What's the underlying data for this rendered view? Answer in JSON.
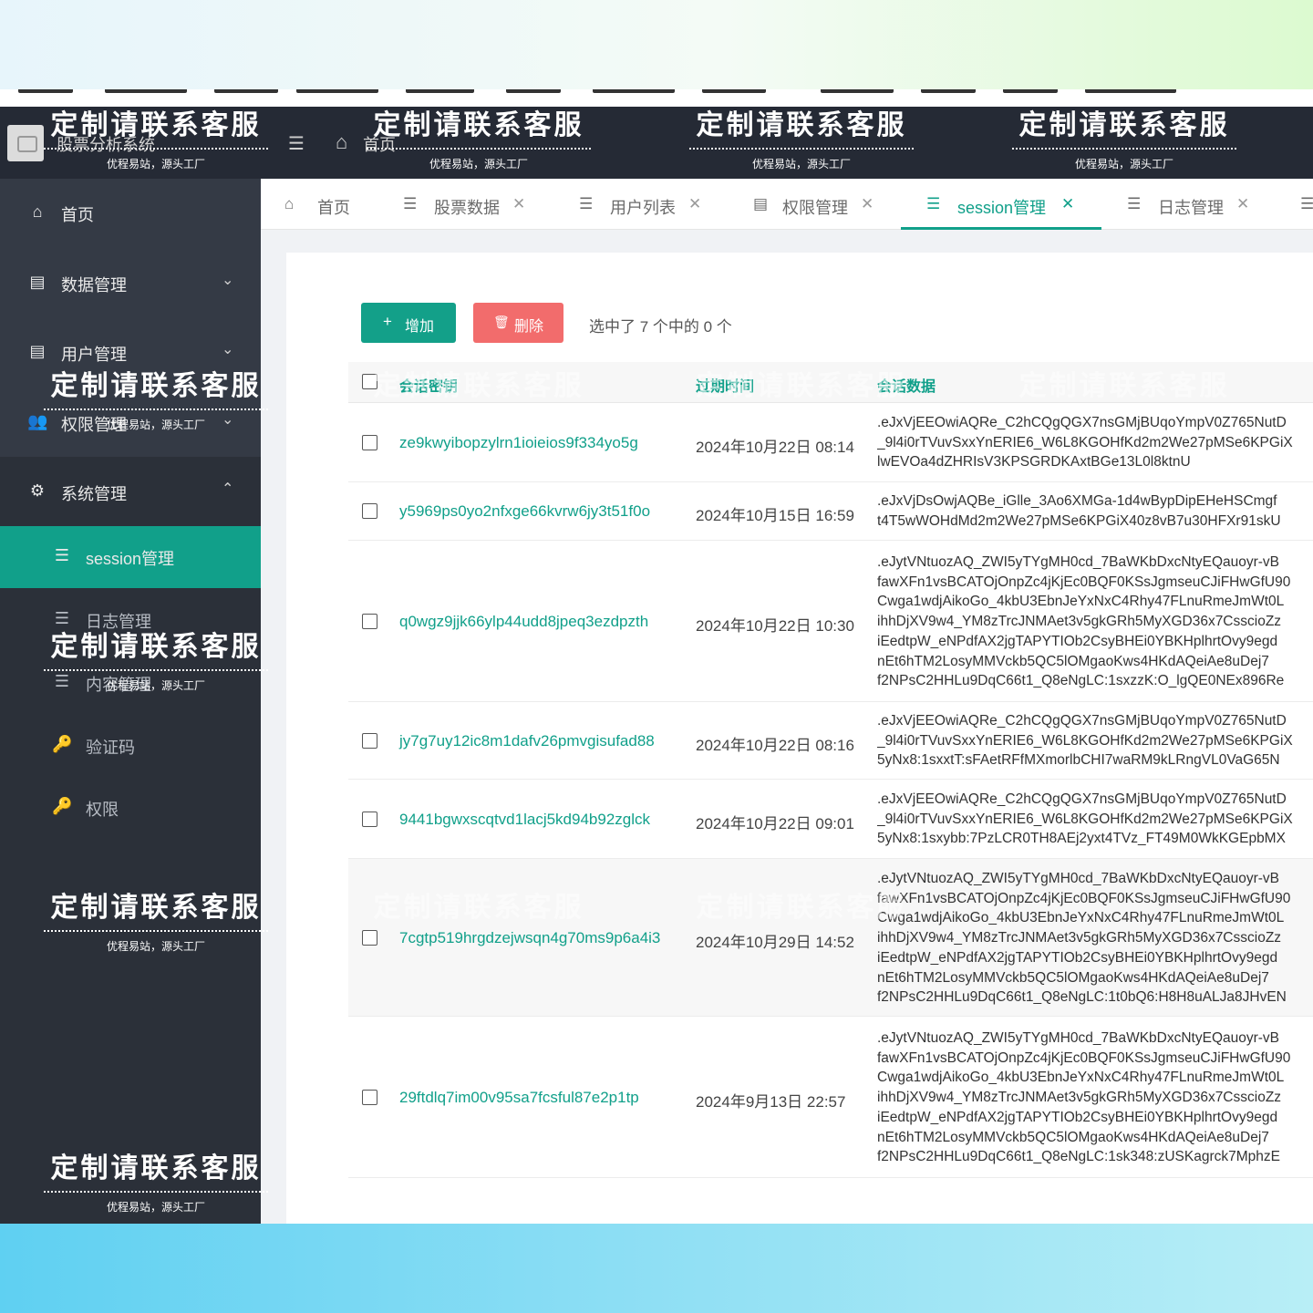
{
  "app": {
    "name": "股票分析系统",
    "header_home": "首页"
  },
  "sidebar": {
    "items": [
      {
        "label": "首页",
        "icon": "home-icon"
      },
      {
        "label": "数据管理",
        "icon": "table-icon"
      },
      {
        "label": "用户管理",
        "icon": "table-icon"
      },
      {
        "label": "权限管理",
        "icon": "users-icon"
      },
      {
        "label": "系统管理",
        "icon": "gear-icon"
      }
    ],
    "sub_items": [
      {
        "label": "session管理",
        "icon": "list-icon"
      },
      {
        "label": "日志管理",
        "icon": "list-icon"
      },
      {
        "label": "内容管理",
        "icon": "list-icon"
      },
      {
        "label": "验证码",
        "icon": "key-icon"
      },
      {
        "label": "权限",
        "icon": "key-icon"
      }
    ]
  },
  "tabs": [
    {
      "label": "首页",
      "icon": "home-icon"
    },
    {
      "label": "股票数据",
      "icon": "list-icon"
    },
    {
      "label": "用户列表",
      "icon": "list-icon"
    },
    {
      "label": "权限管理",
      "icon": "table-icon"
    },
    {
      "label": "session管理",
      "icon": "list-icon"
    },
    {
      "label": "日志管理",
      "icon": "list-icon"
    }
  ],
  "toolbar": {
    "add_label": "增加",
    "delete_label": "删除",
    "selection_text": "选中了 7 个中的 0 个"
  },
  "table": {
    "columns": [
      "会话密钥",
      "过期时间",
      "会话数据"
    ],
    "rows": [
      {
        "key": "ze9kwyibopzylrn1ioieios9f334yo5g",
        "date": "2024年10月22日 08:14",
        "data": [
          ".eJxVjEEOwiAQRe_C2hCQgQGX7nsGMjBUqoYmpV0Z765NutD",
          "_9l4i0rTVuvSxxYnERIE6_W6L8KGOHfKd2m2We27pMSe6KPGiX",
          "lwEVOa4dZHRIsV3KPSGRDKAxtBGe13L0l8ktnU"
        ]
      },
      {
        "key": "y5969ps0yo2nfxge66kvrw6jy3t51f0o",
        "date": "2024年10月15日 16:59",
        "data": [
          ".eJxVjDsOwjAQBe_iGlle_3Ao6XMGa-1d4wBypDipEHeHSCmgf",
          "t4T5wWOHdMd2m2We27pMSe6KPGiX40z8vB7u30HFXr91skU"
        ]
      },
      {
        "key": "q0wgz9jjk66ylp44udd8jpeq3ezdpzth",
        "date": "2024年10月22日 10:30",
        "data": [
          ".eJytVNtuozAQ_ZWI5yTYgMH0cd_7BaWKbDxcNtyEQauoyr-vB",
          "fawXFn1vsBCATOjOnpZc4jKjEc0BQF0KSsJgmseuCJiFHwGfU90",
          "Cwga1wdjAikoGo_4kbU3EbnJeYxNxC4Rhy47FLnuRmeJmWt0L",
          "ihhDjXV9w4_YM8zTrcJNMAet3v5gkGRh5MyXGD36x7CsscioZz",
          "iEedtpW_eNPdfAX2jgTAPYTIOb2CsyBHEi0YBKHplhrtOvy9egd",
          "nEt6hTM2LosyMMVckb5QC5lOMgaoKws4HKdAQeiAe8uDej7",
          "f2NPsC2HHLu9DqC66t1_Q8eNgLC:1sxzzK:O_lgQE0NEx896Re"
        ]
      },
      {
        "key": "jy7g7uy12ic8m1dafv26pmvgisufad88",
        "date": "2024年10月22日 08:16",
        "data": [
          ".eJxVjEEOwiAQRe_C2hCQgQGX7nsGMjBUqoYmpV0Z765NutD",
          "_9l4i0rTVuvSxxYnERIE6_W6L8KGOHfKd2m2We27pMSe6KPGiX",
          "5yNx8:1sxxtT:sFAetRFfMXmorlbCHI7waRM9kLRngVL0VaG65N"
        ]
      },
      {
        "key": "9441bgwxscqtvd1lacj5kd94b92zglck",
        "date": "2024年10月22日 09:01",
        "data": [
          ".eJxVjEEOwiAQRe_C2hCQgQGX7nsGMjBUqoYmpV0Z765NutD",
          "_9l4i0rTVuvSxxYnERIE6_W6L8KGOHfKd2m2We27pMSe6KPGiX",
          "5yNx8:1sxybb:7PzLCR0TH8AEj2yxt4TVz_FT49M0WkKGEpbMX"
        ]
      },
      {
        "key": "7cgtp519hrgdzejwsqn4g70ms9p6a4i3",
        "date": "2024年10月29日 14:52",
        "data": [
          ".eJytVNtuozAQ_ZWI5yTYgMH0cd_7BaWKbDxcNtyEQauoyr-vB",
          "fawXFn1vsBCATOjOnpZc4jKjEc0BQF0KSsJgmseuCJiFHwGfU90",
          "Cwga1wdjAikoGo_4kbU3EbnJeYxNxC4Rhy47FLnuRmeJmWt0L",
          "ihhDjXV9w4_YM8zTrcJNMAet3v5gkGRh5MyXGD36x7CsscioZz",
          "iEedtpW_eNPdfAX2jgTAPYTIOb2CsyBHEi0YBKHplhrtOvy9egd",
          "nEt6hTM2LosyMMVckb5QC5lOMgaoKws4HKdAQeiAe8uDej7",
          "f2NPsC2HHLu9DqC66t1_Q8eNgLC:1t0bQ6:H8H8uALJa8JHvEN"
        ]
      },
      {
        "key": "29ftdlq7im00v95sa7fcsful87e2p1tp",
        "date": "2024年9月13日 22:57",
        "data": [
          ".eJytVNtuozAQ_ZWI5yTYgMH0cd_7BaWKbDxcNtyEQauoyr-vB",
          "fawXFn1vsBCATOjOnpZc4jKjEc0BQF0KSsJgmseuCJiFHwGfU90",
          "Cwga1wdjAikoGo_4kbU3EbnJeYxNxC4Rhy47FLnuRmeJmWt0L",
          "ihhDjXV9w4_YM8zTrcJNMAet3v5gkGRh5MyXGD36x7CsscioZz",
          "iEedtpW_eNPdfAX2jgTAPYTIOb2CsyBHEi0YBKHplhrtOvy9egd",
          "nEt6hTM2LosyMMVckb5QC5lOMgaoKws4HKdAQeiAe8uDej7",
          "f2NPsC2HHLu9DqC66t1_Q8eNgLC:1sk348:zUSKagrck7MphzE"
        ]
      }
    ]
  },
  "watermark": {
    "title": "定制请联系客服",
    "subtitle": "优程易站，源头工厂"
  },
  "colors": {
    "accent": "#11a08a",
    "danger": "#f26c6c",
    "sidebar": "#343a45",
    "header": "#252a35"
  }
}
